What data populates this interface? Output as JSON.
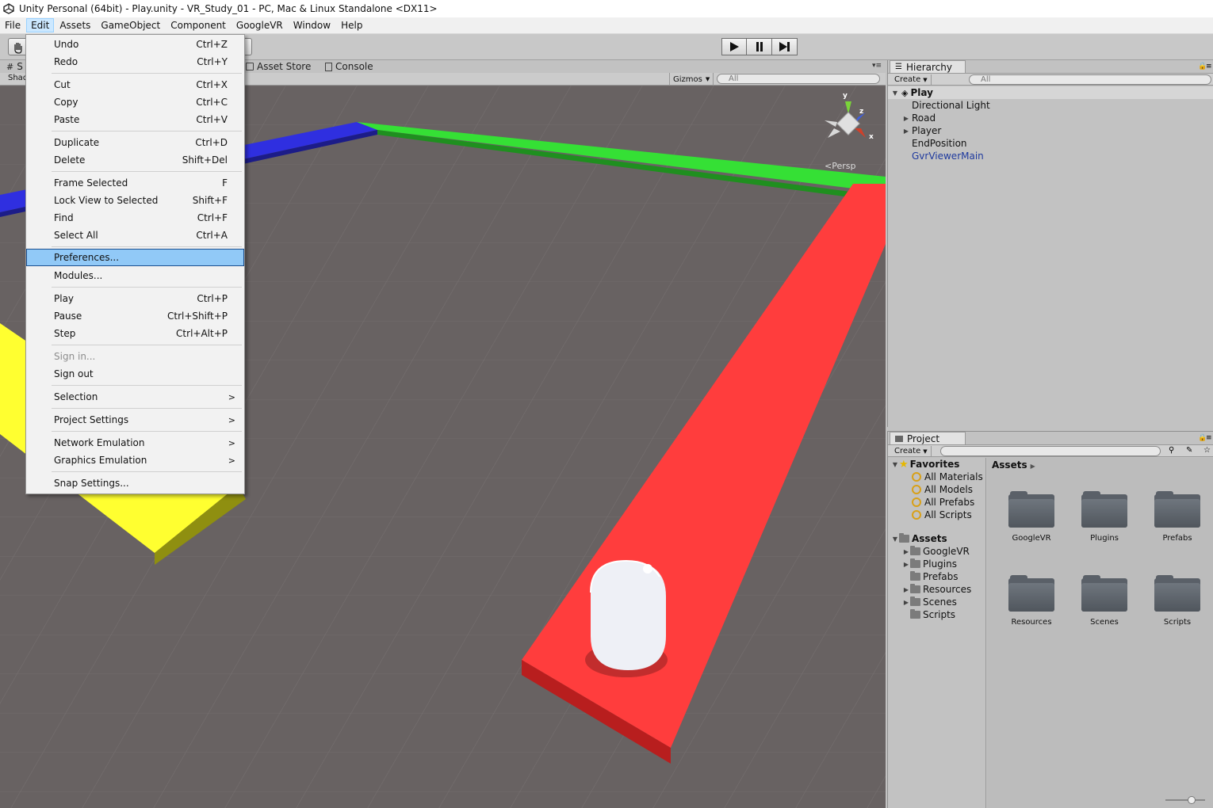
{
  "window": {
    "title": "Unity Personal (64bit) - Play.unity - VR_Study_01 - PC, Mac & Linux Standalone <DX11>"
  },
  "menubar": [
    "File",
    "Edit",
    "Assets",
    "GameObject",
    "Component",
    "GoogleVR",
    "Window",
    "Help"
  ],
  "edit_menu": {
    "undo": {
      "label": "Undo",
      "shortcut": "Ctrl+Z"
    },
    "redo": {
      "label": "Redo",
      "shortcut": "Ctrl+Y"
    },
    "cut": {
      "label": "Cut",
      "shortcut": "Ctrl+X"
    },
    "copy": {
      "label": "Copy",
      "shortcut": "Ctrl+C"
    },
    "paste": {
      "label": "Paste",
      "shortcut": "Ctrl+V"
    },
    "duplicate": {
      "label": "Duplicate",
      "shortcut": "Ctrl+D"
    },
    "delete": {
      "label": "Delete",
      "shortcut": "Shift+Del"
    },
    "frame_selected": {
      "label": "Frame Selected",
      "shortcut": "F"
    },
    "lock_view": {
      "label": "Lock View to Selected",
      "shortcut": "Shift+F"
    },
    "find": {
      "label": "Find",
      "shortcut": "Ctrl+F"
    },
    "select_all": {
      "label": "Select All",
      "shortcut": "Ctrl+A"
    },
    "preferences": {
      "label": "Preferences..."
    },
    "modules": {
      "label": "Modules..."
    },
    "play": {
      "label": "Play",
      "shortcut": "Ctrl+P"
    },
    "pause": {
      "label": "Pause",
      "shortcut": "Ctrl+Shift+P"
    },
    "step": {
      "label": "Step",
      "shortcut": "Ctrl+Alt+P"
    },
    "sign_in": {
      "label": "Sign in..."
    },
    "sign_out": {
      "label": "Sign out"
    },
    "selection": {
      "label": "Selection"
    },
    "project_settings": {
      "label": "Project Settings"
    },
    "network_emulation": {
      "label": "Network Emulation"
    },
    "graphics_emulation": {
      "label": "Graphics Emulation"
    },
    "snap_settings": {
      "label": "Snap Settings..."
    }
  },
  "scene_tabs": {
    "scene": "S",
    "asset_store": "Asset Store",
    "console": "Console",
    "shading": "Shad"
  },
  "scene_toolbar": {
    "gizmos": "Gizmos",
    "search_placeholder": "All"
  },
  "gizmo": {
    "y": "y",
    "z": "z",
    "x": "x",
    "persp": "Persp"
  },
  "hierarchy": {
    "tab": "Hierarchy",
    "create": "Create",
    "search_placeholder": "All",
    "root": "Play",
    "items": [
      "Directional Light",
      "Road",
      "Player",
      "EndPosition",
      "GvrViewerMain"
    ]
  },
  "project": {
    "tab": "Project",
    "create": "Create",
    "favorites_label": "Favorites",
    "favorites": [
      "All Materials",
      "All Models",
      "All Prefabs",
      "All Scripts"
    ],
    "assets_label": "Assets",
    "asset_folders": [
      "GoogleVR",
      "Plugins",
      "Prefabs",
      "Resources",
      "Scenes",
      "Scripts"
    ],
    "breadcrumb": "Assets",
    "grid": [
      "GoogleVR",
      "Plugins",
      "Prefabs",
      "Resources",
      "Scenes",
      "Scripts"
    ]
  },
  "colors": {
    "menu_highlight": "#91c9f7",
    "road_red": "#ff3c3c",
    "road_green": "#33dd33",
    "road_blue": "#2b2bdd",
    "road_yellow": "#ffff2e",
    "hierarchy_prefab_blue": "#1f3a9e"
  }
}
